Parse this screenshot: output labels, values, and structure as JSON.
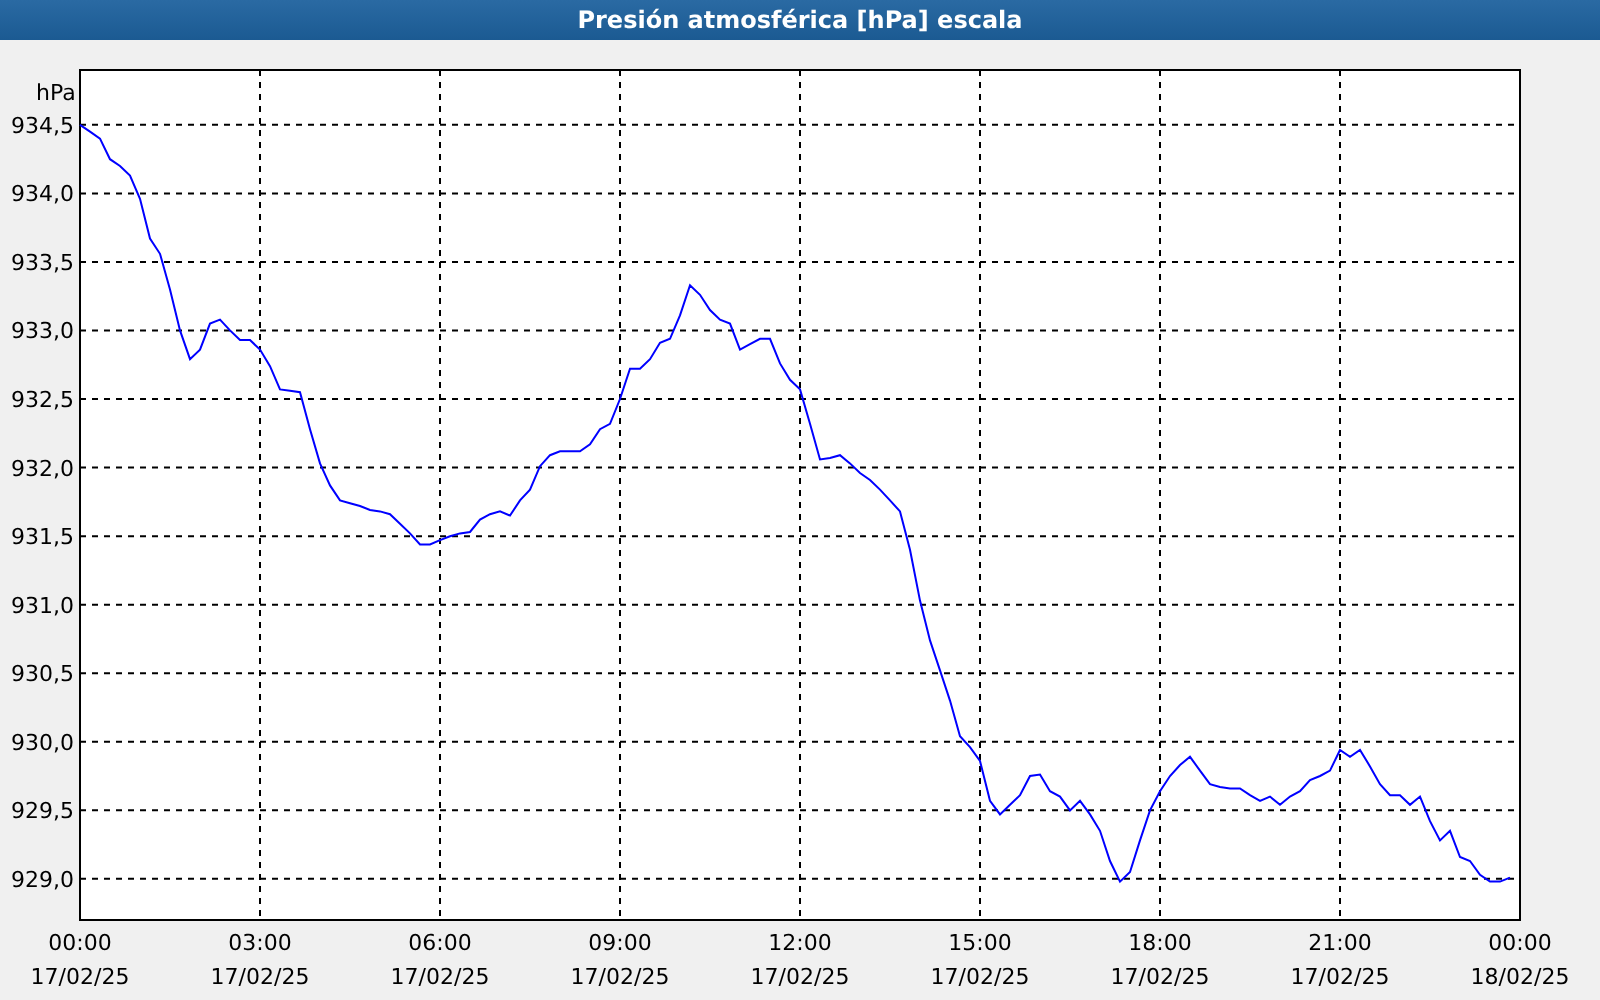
{
  "chart": {
    "chart_data": {
      "type": "line",
      "title": "Presión atmosférica [hPa] escala",
      "ylabel": "hPa",
      "categories": [
        "00:00 17/02/25",
        null,
        null,
        null,
        null,
        null,
        null,
        null,
        null,
        null,
        null,
        null,
        null,
        null,
        null,
        null,
        null,
        null,
        "03:00 17/02/25",
        null,
        null,
        null,
        null,
        null,
        null,
        null,
        null,
        null,
        null,
        null,
        null,
        null,
        null,
        null,
        null,
        null,
        "06:00 17/02/25",
        null,
        null,
        null,
        null,
        null,
        null,
        null,
        null,
        null,
        null,
        null,
        null,
        null,
        null,
        null,
        null,
        null,
        "09:00 17/02/25",
        null,
        null,
        null,
        null,
        null,
        null,
        null,
        null,
        null,
        null,
        null,
        null,
        null,
        null,
        null,
        null,
        null,
        "12:00 17/02/25",
        null,
        null,
        null,
        null,
        null,
        null,
        null,
        null,
        null,
        null,
        null,
        null,
        null,
        null,
        null,
        null,
        null,
        "15:00 17/02/25",
        null,
        null,
        null,
        null,
        null,
        null,
        null,
        null,
        null,
        null,
        null,
        null,
        null,
        null,
        null,
        null,
        null,
        "18:00 17/02/25",
        null,
        null,
        null,
        null,
        null,
        null,
        null,
        null,
        null,
        null,
        null,
        null,
        null,
        null,
        null,
        null,
        null,
        "21:00 17/02/25",
        null,
        null,
        null,
        null,
        null,
        null,
        null,
        null,
        null,
        null,
        null,
        null,
        null,
        null,
        null,
        null,
        null,
        "00:00 18/02/25"
      ],
      "series": [
        {
          "color": "#0000ff",
          "values": [
            934.5,
            934.45,
            934.4,
            934.25,
            934.2,
            934.13,
            933.96,
            933.67,
            933.56,
            933.3,
            933.0,
            932.79,
            932.86,
            933.05,
            933.08,
            933.0,
            932.93,
            932.93,
            932.86,
            932.74,
            932.57,
            932.56,
            932.55,
            932.28,
            932.03,
            931.87,
            931.76,
            931.74,
            931.72,
            931.69,
            931.68,
            931.66,
            931.59,
            931.52,
            931.44,
            931.44,
            931.47,
            931.5,
            931.52,
            931.53,
            931.62,
            931.66,
            931.68,
            931.65,
            931.76,
            931.84,
            932.01,
            932.09,
            932.12,
            932.12,
            932.12,
            932.17,
            932.28,
            932.32,
            932.5,
            932.72,
            932.72,
            932.79,
            932.91,
            932.94,
            933.11,
            933.33,
            933.26,
            933.15,
            933.08,
            933.05,
            932.86,
            932.9,
            932.94,
            932.94,
            932.76,
            932.64,
            932.57,
            932.32,
            932.06,
            932.07,
            932.09,
            932.03,
            931.96,
            931.91,
            931.84,
            931.76,
            931.68,
            931.4,
            931.03,
            930.74,
            930.52,
            930.3,
            930.04,
            929.96,
            929.86,
            929.57,
            929.47,
            929.54,
            929.61,
            929.75,
            929.76,
            929.64,
            929.6,
            929.5,
            929.57,
            929.47,
            929.35,
            929.13,
            928.98,
            929.05,
            929.28,
            929.5,
            929.64,
            929.75,
            929.83,
            929.89,
            929.79,
            929.69,
            929.67,
            929.66,
            929.66,
            929.61,
            929.57,
            929.6,
            929.54,
            929.6,
            929.64,
            929.72,
            929.75,
            929.79,
            929.94,
            929.89,
            929.94,
            929.82,
            929.69,
            929.61,
            929.61,
            929.54,
            929.6,
            929.42,
            929.28,
            929.35,
            929.16,
            929.13,
            929.03,
            928.98,
            928.98,
            929.01,
            null
          ]
        }
      ],
      "ylim": [
        928.7,
        934.9
      ],
      "grid": true,
      "yticks": [
        {
          "value": 929,
          "label": "929,0"
        },
        {
          "value": 929.5,
          "label": "929,5"
        },
        {
          "value": 930,
          "label": "930,0"
        },
        {
          "value": 930.5,
          "label": "930,5"
        },
        {
          "value": 931,
          "label": "931,0"
        },
        {
          "value": 931.5,
          "label": "931,5"
        },
        {
          "value": 932,
          "label": "932,0"
        },
        {
          "value": 932.5,
          "label": "932,5"
        },
        {
          "value": 933,
          "label": "933,0"
        },
        {
          "value": 933.5,
          "label": "933,5"
        },
        {
          "value": 934,
          "label": "934,0"
        },
        {
          "value": 934.5,
          "label": "934,5"
        }
      ]
    }
  }
}
